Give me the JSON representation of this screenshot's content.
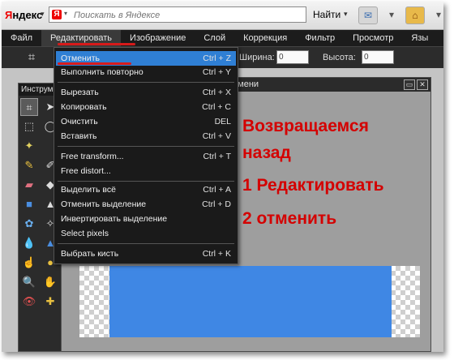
{
  "browser": {
    "logo": "Яндекс",
    "search_placeholder": "Поискать в Яндексе",
    "find_button": "Найти"
  },
  "menubar": {
    "items": [
      "Файл",
      "Редактировать",
      "Изображение",
      "Слой",
      "Коррекция",
      "Фильтр",
      "Просмотр",
      "Язы"
    ]
  },
  "options": {
    "width_label": "Ширина:",
    "width_value": "0",
    "height_label": "Высота:",
    "height_value": "0"
  },
  "tools_panel": {
    "title": "Инструм"
  },
  "document": {
    "title": "имени"
  },
  "edit_menu": {
    "groups": [
      [
        {
          "label": "Отменить",
          "shortcut": "Ctrl + Z"
        },
        {
          "label": "Выполнить повторно",
          "shortcut": "Ctrl + Y"
        }
      ],
      [
        {
          "label": "Вырезать",
          "shortcut": "Ctrl + X"
        },
        {
          "label": "Копировать",
          "shortcut": "Ctrl + C"
        },
        {
          "label": "Очистить",
          "shortcut": "DEL"
        },
        {
          "label": "Вставить",
          "shortcut": "Ctrl + V"
        }
      ],
      [
        {
          "label": "Free transform...",
          "shortcut": "Ctrl + T"
        },
        {
          "label": "Free distort...",
          "shortcut": ""
        }
      ],
      [
        {
          "label": "Выделить всё",
          "shortcut": "Ctrl + A"
        },
        {
          "label": "Отменить выделение",
          "shortcut": "Ctrl + D"
        },
        {
          "label": "Инвертировать выделение",
          "shortcut": ""
        },
        {
          "label": "Select pixels",
          "shortcut": ""
        }
      ],
      [
        {
          "label": "Выбрать кисть",
          "shortcut": "Ctrl + K"
        }
      ]
    ]
  },
  "annotation": {
    "line1": "Возвращаемся",
    "line2": "назад",
    "line3": "1 Редактировать",
    "line4": "2 отменить"
  },
  "colors": {
    "menu_highlight": "#2f7fd4",
    "annotation_red": "#d40000",
    "canvas_blue": "#3f87e4"
  }
}
